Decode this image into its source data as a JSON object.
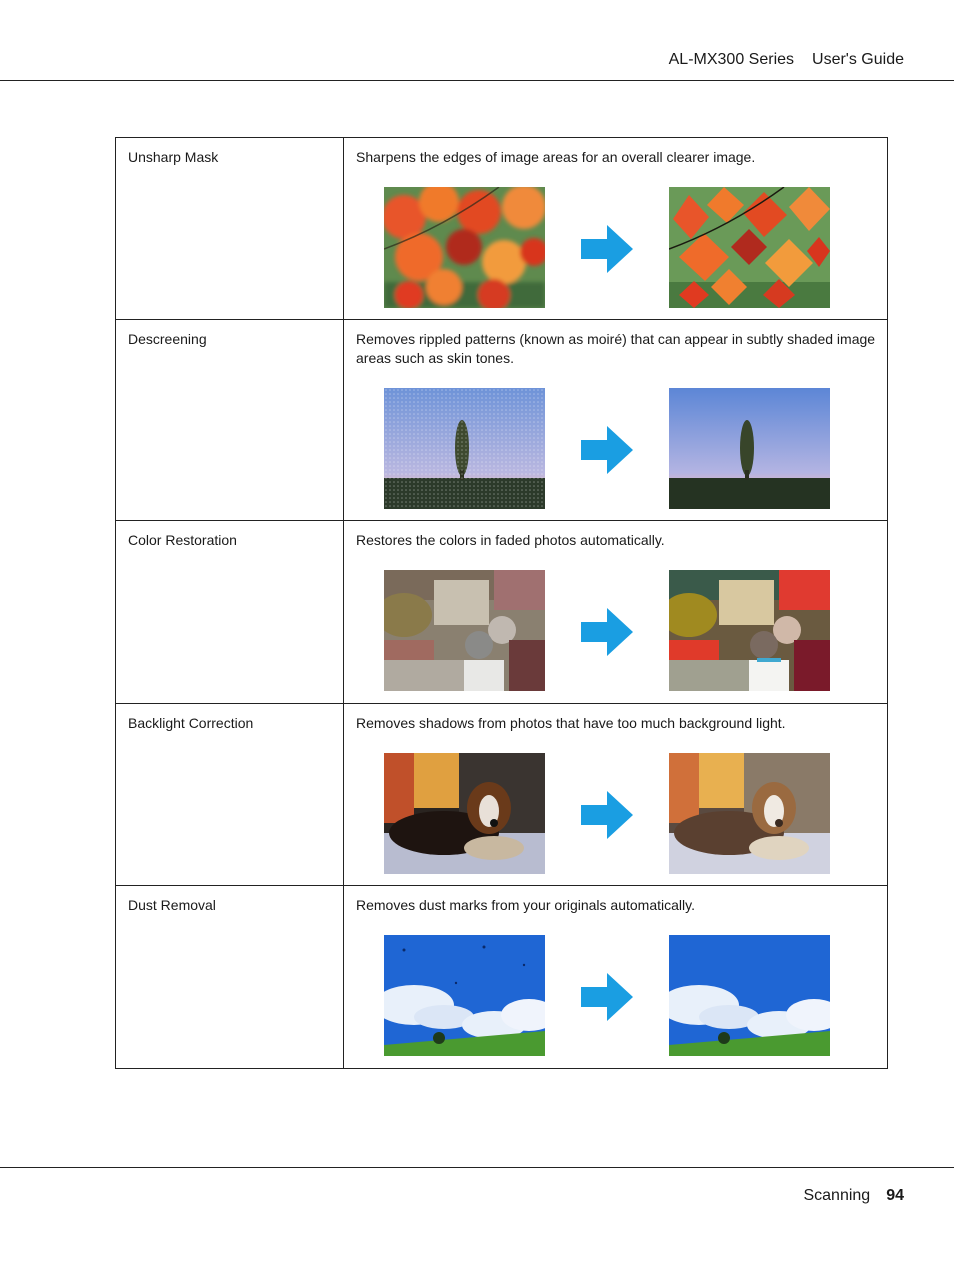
{
  "header": {
    "product": "AL-MX300 Series",
    "guide": "User's Guide"
  },
  "colors": {
    "arrow": "#1a9ee2",
    "rule": "#222222"
  },
  "table": {
    "rows": [
      {
        "name": "Unsharp Mask",
        "description": "Sharpens the edges of image areas for an overall clearer image.",
        "before_image": "autumn-leaves-blurry",
        "after_image": "autumn-leaves-sharp"
      },
      {
        "name": "Descreening",
        "description": "Removes rippled patterns (known as moiré) that can appear in subtly shaded image areas such as skin tones.",
        "before_image": "tree-sky-moire",
        "after_image": "tree-sky-clean"
      },
      {
        "name": "Color Restoration",
        "description": "Restores the colors in faded photos automatically.",
        "before_image": "market-scene-faded",
        "after_image": "market-scene-restored"
      },
      {
        "name": "Backlight Correction",
        "description": "Removes shadows from photos that have too much background light.",
        "before_image": "dog-backlit-dark",
        "after_image": "dog-corrected"
      },
      {
        "name": "Dust Removal",
        "description": "Removes dust marks from your originals automatically.",
        "before_image": "sky-clouds-dusty",
        "after_image": "sky-clouds-clean"
      }
    ]
  },
  "footer": {
    "section": "Scanning",
    "page": "94"
  }
}
